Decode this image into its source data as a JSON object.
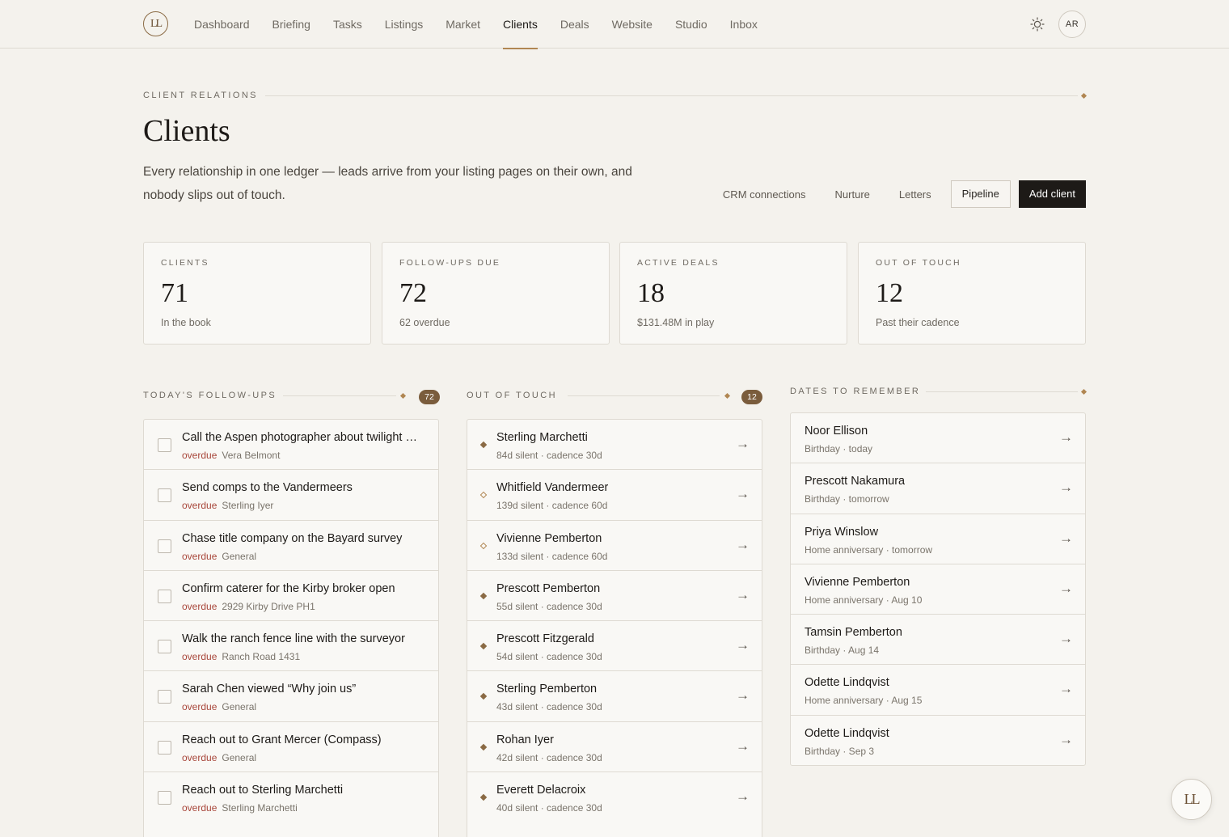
{
  "brand": {
    "logo_text": "LL"
  },
  "nav": {
    "items": [
      {
        "label": "Dashboard"
      },
      {
        "label": "Briefing"
      },
      {
        "label": "Tasks"
      },
      {
        "label": "Listings"
      },
      {
        "label": "Market"
      },
      {
        "label": "Clients"
      },
      {
        "label": "Deals"
      },
      {
        "label": "Website"
      },
      {
        "label": "Studio"
      },
      {
        "label": "Inbox"
      }
    ],
    "active": "Clients",
    "theme_icon": "sun-icon",
    "avatar_initials": "AR"
  },
  "header": {
    "eyebrow": "CLIENT RELATIONS",
    "title": "Clients",
    "subtitle": "Every relationship in one ledger — leads arrive from your listing pages on their own, and nobody slips out of touch.",
    "actions": {
      "crm": "CRM connections",
      "nurture": "Nurture",
      "letters": "Letters",
      "pipeline": "Pipeline",
      "add": "Add client"
    }
  },
  "stats": [
    {
      "label": "CLIENTS",
      "value": "71",
      "sub": "In the book"
    },
    {
      "label": "FOLLOW-UPS DUE",
      "value": "72",
      "sub": "62 overdue"
    },
    {
      "label": "ACTIVE DEALS",
      "value": "18",
      "sub": "$131.48M in play"
    },
    {
      "label": "OUT OF TOUCH",
      "value": "12",
      "sub": "Past their cadence"
    }
  ],
  "followups": {
    "title": "TODAY'S FOLLOW-UPS",
    "count": "72",
    "items": [
      {
        "title": "Call the Aspen photographer about twilight …",
        "status": "overdue",
        "context": "Vera Belmont"
      },
      {
        "title": "Send comps to the Vandermeers",
        "status": "overdue",
        "context": "Sterling Iyer"
      },
      {
        "title": "Chase title company on the Bayard survey",
        "status": "overdue",
        "context": "General"
      },
      {
        "title": "Confirm caterer for the Kirby broker open",
        "status": "overdue",
        "context": "2929 Kirby Drive PH1"
      },
      {
        "title": "Walk the ranch fence line with the surveyor",
        "status": "overdue",
        "context": "Ranch Road 1431"
      },
      {
        "title": "Sarah Chen viewed “Why join us”",
        "status": "overdue",
        "context": "General"
      },
      {
        "title": "Reach out to Grant Mercer (Compass)",
        "status": "overdue",
        "context": "General"
      },
      {
        "title": "Reach out to Sterling Marchetti",
        "status": "overdue",
        "context": "Sterling Marchetti"
      }
    ]
  },
  "out_of_touch": {
    "title": "OUT OF TOUCH",
    "count": "12",
    "items": [
      {
        "name": "Sterling Marchetti",
        "detail": "84d silent · cadence 30d",
        "marker": "filled"
      },
      {
        "name": "Whitfield Vandermeer",
        "detail": "139d silent · cadence 60d",
        "marker": "hollow"
      },
      {
        "name": "Vivienne Pemberton",
        "detail": "133d silent · cadence 60d",
        "marker": "hollow"
      },
      {
        "name": "Prescott Pemberton",
        "detail": "55d silent · cadence 30d",
        "marker": "filled"
      },
      {
        "name": "Prescott Fitzgerald",
        "detail": "54d silent · cadence 30d",
        "marker": "filled"
      },
      {
        "name": "Sterling Pemberton",
        "detail": "43d silent · cadence 30d",
        "marker": "filled"
      },
      {
        "name": "Rohan Iyer",
        "detail": "42d silent · cadence 30d",
        "marker": "filled"
      },
      {
        "name": "Everett Delacroix",
        "detail": "40d silent · cadence 30d",
        "marker": "filled"
      }
    ]
  },
  "dates": {
    "title": "DATES TO REMEMBER",
    "items": [
      {
        "name": "Noor Ellison",
        "detail": "Birthday · today"
      },
      {
        "name": "Prescott Nakamura",
        "detail": "Birthday · tomorrow"
      },
      {
        "name": "Priya Winslow",
        "detail": "Home anniversary · tomorrow"
      },
      {
        "name": "Vivienne Pemberton",
        "detail": "Home anniversary · Aug 10"
      },
      {
        "name": "Tamsin Pemberton",
        "detail": "Birthday · Aug 14"
      },
      {
        "name": "Odette Lindqvist",
        "detail": "Home anniversary · Aug 15"
      },
      {
        "name": "Odette Lindqvist",
        "detail": "Birthday · Sep 3"
      }
    ]
  },
  "ui": {
    "arrow": "→"
  },
  "colors": {
    "accent": "#b08652",
    "overdue": "#a8463a",
    "badge": "#7a5c3c",
    "primary_button": "#1d1a17"
  }
}
